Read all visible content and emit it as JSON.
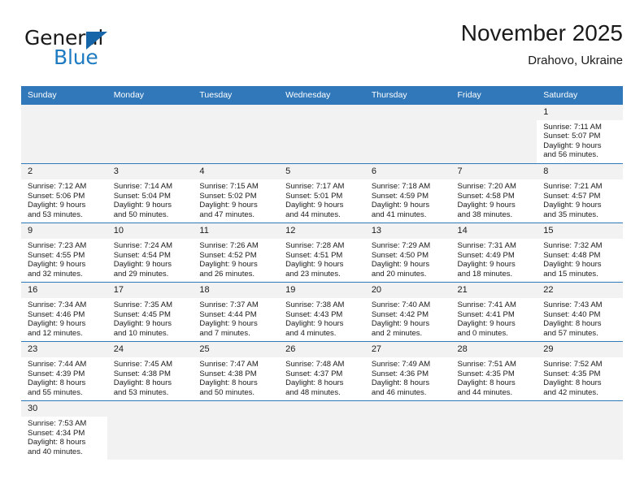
{
  "brand": {
    "name_primary": "General",
    "name_secondary": "Blue",
    "triangle_color": "#1565a8",
    "secondary_color": "#1f7bc1"
  },
  "header": {
    "title": "November 2025",
    "subtitle": "Drahovo, Ukraine"
  },
  "colors": {
    "header_bar": "#3178ba",
    "daynum_bg": "#f2f2f2",
    "text": "#1a1a1a"
  },
  "weekday_headers": [
    "Sunday",
    "Monday",
    "Tuesday",
    "Wednesday",
    "Thursday",
    "Friday",
    "Saturday"
  ],
  "labels": {
    "sunrise_prefix": "Sunrise:",
    "sunset_prefix": "Sunset:",
    "daylight_prefix": "Daylight:"
  },
  "weeks": [
    [
      {
        "day": "",
        "empty": true,
        "line1": "",
        "line2": "",
        "line3": "",
        "line4": ""
      },
      {
        "day": "",
        "empty": true,
        "line1": "",
        "line2": "",
        "line3": "",
        "line4": ""
      },
      {
        "day": "",
        "empty": true,
        "line1": "",
        "line2": "",
        "line3": "",
        "line4": ""
      },
      {
        "day": "",
        "empty": true,
        "line1": "",
        "line2": "",
        "line3": "",
        "line4": ""
      },
      {
        "day": "",
        "empty": true,
        "line1": "",
        "line2": "",
        "line3": "",
        "line4": ""
      },
      {
        "day": "",
        "empty": true,
        "line1": "",
        "line2": "",
        "line3": "",
        "line4": ""
      },
      {
        "day": "1",
        "empty": false,
        "line1": "Sunrise: 7:11 AM",
        "line2": "Sunset: 5:07 PM",
        "line3": "Daylight: 9 hours",
        "line4": "and 56 minutes."
      }
    ],
    [
      {
        "day": "2",
        "empty": false,
        "line1": "Sunrise: 7:12 AM",
        "line2": "Sunset: 5:06 PM",
        "line3": "Daylight: 9 hours",
        "line4": "and 53 minutes."
      },
      {
        "day": "3",
        "empty": false,
        "line1": "Sunrise: 7:14 AM",
        "line2": "Sunset: 5:04 PM",
        "line3": "Daylight: 9 hours",
        "line4": "and 50 minutes."
      },
      {
        "day": "4",
        "empty": false,
        "line1": "Sunrise: 7:15 AM",
        "line2": "Sunset: 5:02 PM",
        "line3": "Daylight: 9 hours",
        "line4": "and 47 minutes."
      },
      {
        "day": "5",
        "empty": false,
        "line1": "Sunrise: 7:17 AM",
        "line2": "Sunset: 5:01 PM",
        "line3": "Daylight: 9 hours",
        "line4": "and 44 minutes."
      },
      {
        "day": "6",
        "empty": false,
        "line1": "Sunrise: 7:18 AM",
        "line2": "Sunset: 4:59 PM",
        "line3": "Daylight: 9 hours",
        "line4": "and 41 minutes."
      },
      {
        "day": "7",
        "empty": false,
        "line1": "Sunrise: 7:20 AM",
        "line2": "Sunset: 4:58 PM",
        "line3": "Daylight: 9 hours",
        "line4": "and 38 minutes."
      },
      {
        "day": "8",
        "empty": false,
        "line1": "Sunrise: 7:21 AM",
        "line2": "Sunset: 4:57 PM",
        "line3": "Daylight: 9 hours",
        "line4": "and 35 minutes."
      }
    ],
    [
      {
        "day": "9",
        "empty": false,
        "line1": "Sunrise: 7:23 AM",
        "line2": "Sunset: 4:55 PM",
        "line3": "Daylight: 9 hours",
        "line4": "and 32 minutes."
      },
      {
        "day": "10",
        "empty": false,
        "line1": "Sunrise: 7:24 AM",
        "line2": "Sunset: 4:54 PM",
        "line3": "Daylight: 9 hours",
        "line4": "and 29 minutes."
      },
      {
        "day": "11",
        "empty": false,
        "line1": "Sunrise: 7:26 AM",
        "line2": "Sunset: 4:52 PM",
        "line3": "Daylight: 9 hours",
        "line4": "and 26 minutes."
      },
      {
        "day": "12",
        "empty": false,
        "line1": "Sunrise: 7:28 AM",
        "line2": "Sunset: 4:51 PM",
        "line3": "Daylight: 9 hours",
        "line4": "and 23 minutes."
      },
      {
        "day": "13",
        "empty": false,
        "line1": "Sunrise: 7:29 AM",
        "line2": "Sunset: 4:50 PM",
        "line3": "Daylight: 9 hours",
        "line4": "and 20 minutes."
      },
      {
        "day": "14",
        "empty": false,
        "line1": "Sunrise: 7:31 AM",
        "line2": "Sunset: 4:49 PM",
        "line3": "Daylight: 9 hours",
        "line4": "and 18 minutes."
      },
      {
        "day": "15",
        "empty": false,
        "line1": "Sunrise: 7:32 AM",
        "line2": "Sunset: 4:48 PM",
        "line3": "Daylight: 9 hours",
        "line4": "and 15 minutes."
      }
    ],
    [
      {
        "day": "16",
        "empty": false,
        "line1": "Sunrise: 7:34 AM",
        "line2": "Sunset: 4:46 PM",
        "line3": "Daylight: 9 hours",
        "line4": "and 12 minutes."
      },
      {
        "day": "17",
        "empty": false,
        "line1": "Sunrise: 7:35 AM",
        "line2": "Sunset: 4:45 PM",
        "line3": "Daylight: 9 hours",
        "line4": "and 10 minutes."
      },
      {
        "day": "18",
        "empty": false,
        "line1": "Sunrise: 7:37 AM",
        "line2": "Sunset: 4:44 PM",
        "line3": "Daylight: 9 hours",
        "line4": "and 7 minutes."
      },
      {
        "day": "19",
        "empty": false,
        "line1": "Sunrise: 7:38 AM",
        "line2": "Sunset: 4:43 PM",
        "line3": "Daylight: 9 hours",
        "line4": "and 4 minutes."
      },
      {
        "day": "20",
        "empty": false,
        "line1": "Sunrise: 7:40 AM",
        "line2": "Sunset: 4:42 PM",
        "line3": "Daylight: 9 hours",
        "line4": "and 2 minutes."
      },
      {
        "day": "21",
        "empty": false,
        "line1": "Sunrise: 7:41 AM",
        "line2": "Sunset: 4:41 PM",
        "line3": "Daylight: 9 hours",
        "line4": "and 0 minutes."
      },
      {
        "day": "22",
        "empty": false,
        "line1": "Sunrise: 7:43 AM",
        "line2": "Sunset: 4:40 PM",
        "line3": "Daylight: 8 hours",
        "line4": "and 57 minutes."
      }
    ],
    [
      {
        "day": "23",
        "empty": false,
        "line1": "Sunrise: 7:44 AM",
        "line2": "Sunset: 4:39 PM",
        "line3": "Daylight: 8 hours",
        "line4": "and 55 minutes."
      },
      {
        "day": "24",
        "empty": false,
        "line1": "Sunrise: 7:45 AM",
        "line2": "Sunset: 4:38 PM",
        "line3": "Daylight: 8 hours",
        "line4": "and 53 minutes."
      },
      {
        "day": "25",
        "empty": false,
        "line1": "Sunrise: 7:47 AM",
        "line2": "Sunset: 4:38 PM",
        "line3": "Daylight: 8 hours",
        "line4": "and 50 minutes."
      },
      {
        "day": "26",
        "empty": false,
        "line1": "Sunrise: 7:48 AM",
        "line2": "Sunset: 4:37 PM",
        "line3": "Daylight: 8 hours",
        "line4": "and 48 minutes."
      },
      {
        "day": "27",
        "empty": false,
        "line1": "Sunrise: 7:49 AM",
        "line2": "Sunset: 4:36 PM",
        "line3": "Daylight: 8 hours",
        "line4": "and 46 minutes."
      },
      {
        "day": "28",
        "empty": false,
        "line1": "Sunrise: 7:51 AM",
        "line2": "Sunset: 4:35 PM",
        "line3": "Daylight: 8 hours",
        "line4": "and 44 minutes."
      },
      {
        "day": "29",
        "empty": false,
        "line1": "Sunrise: 7:52 AM",
        "line2": "Sunset: 4:35 PM",
        "line3": "Daylight: 8 hours",
        "line4": "and 42 minutes."
      }
    ],
    [
      {
        "day": "30",
        "empty": false,
        "line1": "Sunrise: 7:53 AM",
        "line2": "Sunset: 4:34 PM",
        "line3": "Daylight: 8 hours",
        "line4": "and 40 minutes."
      },
      {
        "day": "",
        "empty": true,
        "line1": "",
        "line2": "",
        "line3": "",
        "line4": ""
      },
      {
        "day": "",
        "empty": true,
        "line1": "",
        "line2": "",
        "line3": "",
        "line4": ""
      },
      {
        "day": "",
        "empty": true,
        "line1": "",
        "line2": "",
        "line3": "",
        "line4": ""
      },
      {
        "day": "",
        "empty": true,
        "line1": "",
        "line2": "",
        "line3": "",
        "line4": ""
      },
      {
        "day": "",
        "empty": true,
        "line1": "",
        "line2": "",
        "line3": "",
        "line4": ""
      },
      {
        "day": "",
        "empty": true,
        "line1": "",
        "line2": "",
        "line3": "",
        "line4": ""
      }
    ]
  ]
}
